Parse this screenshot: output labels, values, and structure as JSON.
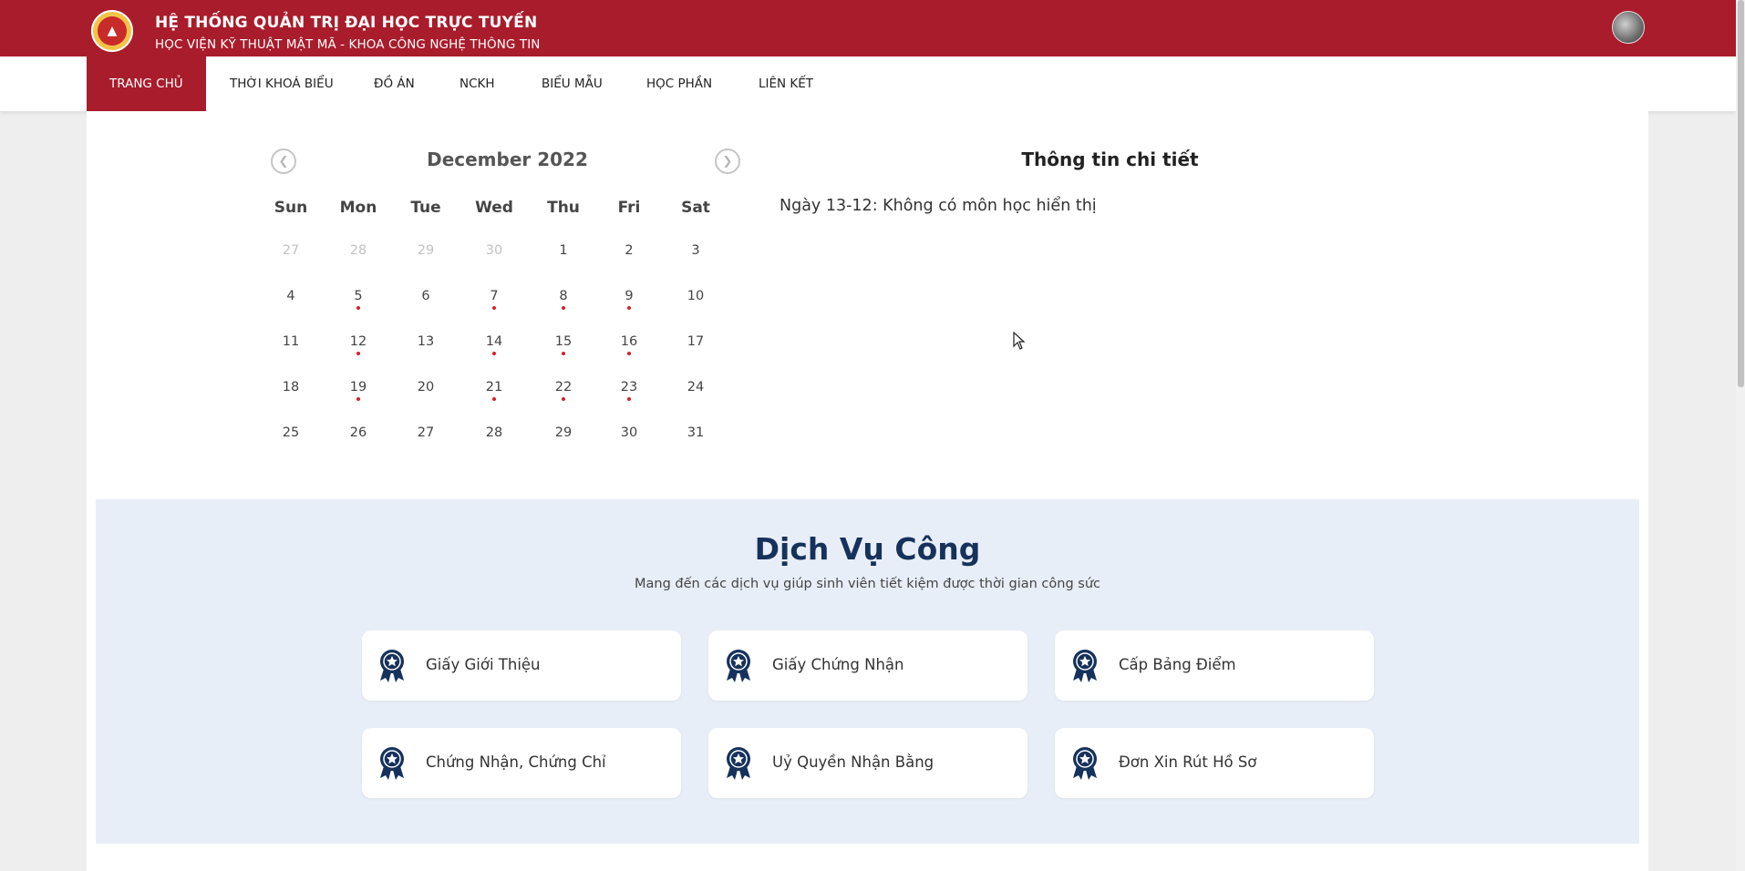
{
  "header": {
    "title": "HỆ THỐNG QUẢN TRỊ ĐẠI HỌC TRỰC TUYẾN",
    "subtitle": "HỌC VIỆN KỸ THUẬT MẬT MÃ - KHOA CÔNG NGHỆ THÔNG TIN",
    "brand_color": "#a91c2b"
  },
  "nav": {
    "items": [
      {
        "label": "TRANG CHỦ",
        "active": true
      },
      {
        "label": "THỜI KHOÁ BIỂU",
        "active": false
      },
      {
        "label": "ĐỒ ÁN",
        "active": false
      },
      {
        "label": "NCKH",
        "active": false
      },
      {
        "label": "BIỂU MẪU",
        "active": false
      },
      {
        "label": "HỌC PHẦN",
        "active": false
      },
      {
        "label": "LIÊN KẾT",
        "active": false
      }
    ]
  },
  "calendar": {
    "month_label": "December 2022",
    "weekdays": [
      "Sun",
      "Mon",
      "Tue",
      "Wed",
      "Thu",
      "Fri",
      "Sat"
    ],
    "weeks": [
      [
        {
          "d": "27",
          "muted": true
        },
        {
          "d": "28",
          "muted": true
        },
        {
          "d": "29",
          "muted": true
        },
        {
          "d": "30",
          "muted": true
        },
        {
          "d": "1"
        },
        {
          "d": "2"
        },
        {
          "d": "3"
        }
      ],
      [
        {
          "d": "4"
        },
        {
          "d": "5",
          "dot": true
        },
        {
          "d": "6"
        },
        {
          "d": "7",
          "dot": true
        },
        {
          "d": "8",
          "dot": true
        },
        {
          "d": "9",
          "dot": true
        },
        {
          "d": "10"
        }
      ],
      [
        {
          "d": "11"
        },
        {
          "d": "12",
          "dot": true
        },
        {
          "d": "13",
          "selected": true
        },
        {
          "d": "14",
          "dot": true
        },
        {
          "d": "15",
          "dot": true
        },
        {
          "d": "16",
          "dot": true
        },
        {
          "d": "17"
        }
      ],
      [
        {
          "d": "18"
        },
        {
          "d": "19",
          "dot": true
        },
        {
          "d": "20"
        },
        {
          "d": "21",
          "dot": true
        },
        {
          "d": "22",
          "dot": true
        },
        {
          "d": "23",
          "dot": true
        },
        {
          "d": "24"
        }
      ],
      [
        {
          "d": "25"
        },
        {
          "d": "26"
        },
        {
          "d": "27"
        },
        {
          "d": "28"
        },
        {
          "d": "29"
        },
        {
          "d": "30"
        },
        {
          "d": "31"
        }
      ]
    ],
    "prev_icon": "chevron-left-icon",
    "next_icon": "chevron-right-icon"
  },
  "detail": {
    "title": "Thông tin chi tiết",
    "text": "Ngày 13-12: Không có môn học hiển thị"
  },
  "services": {
    "title": "Dịch Vụ Công",
    "subtitle": "Mang đến các dịch vụ giúp sinh viên tiết kiệm được thời gian công sức",
    "icon": "award-ribbon-icon",
    "accent": "#16325c",
    "cards": [
      {
        "label": "Giấy Giới Thiệu"
      },
      {
        "label": "Giấy Chứng Nhận"
      },
      {
        "label": "Cấp Bảng Điểm"
      },
      {
        "label": "Chứng Nhận, Chứng Chỉ"
      },
      {
        "label": "Uỷ Quyền Nhận Bằng"
      },
      {
        "label": "Đơn Xin Rút Hồ Sơ"
      }
    ]
  }
}
